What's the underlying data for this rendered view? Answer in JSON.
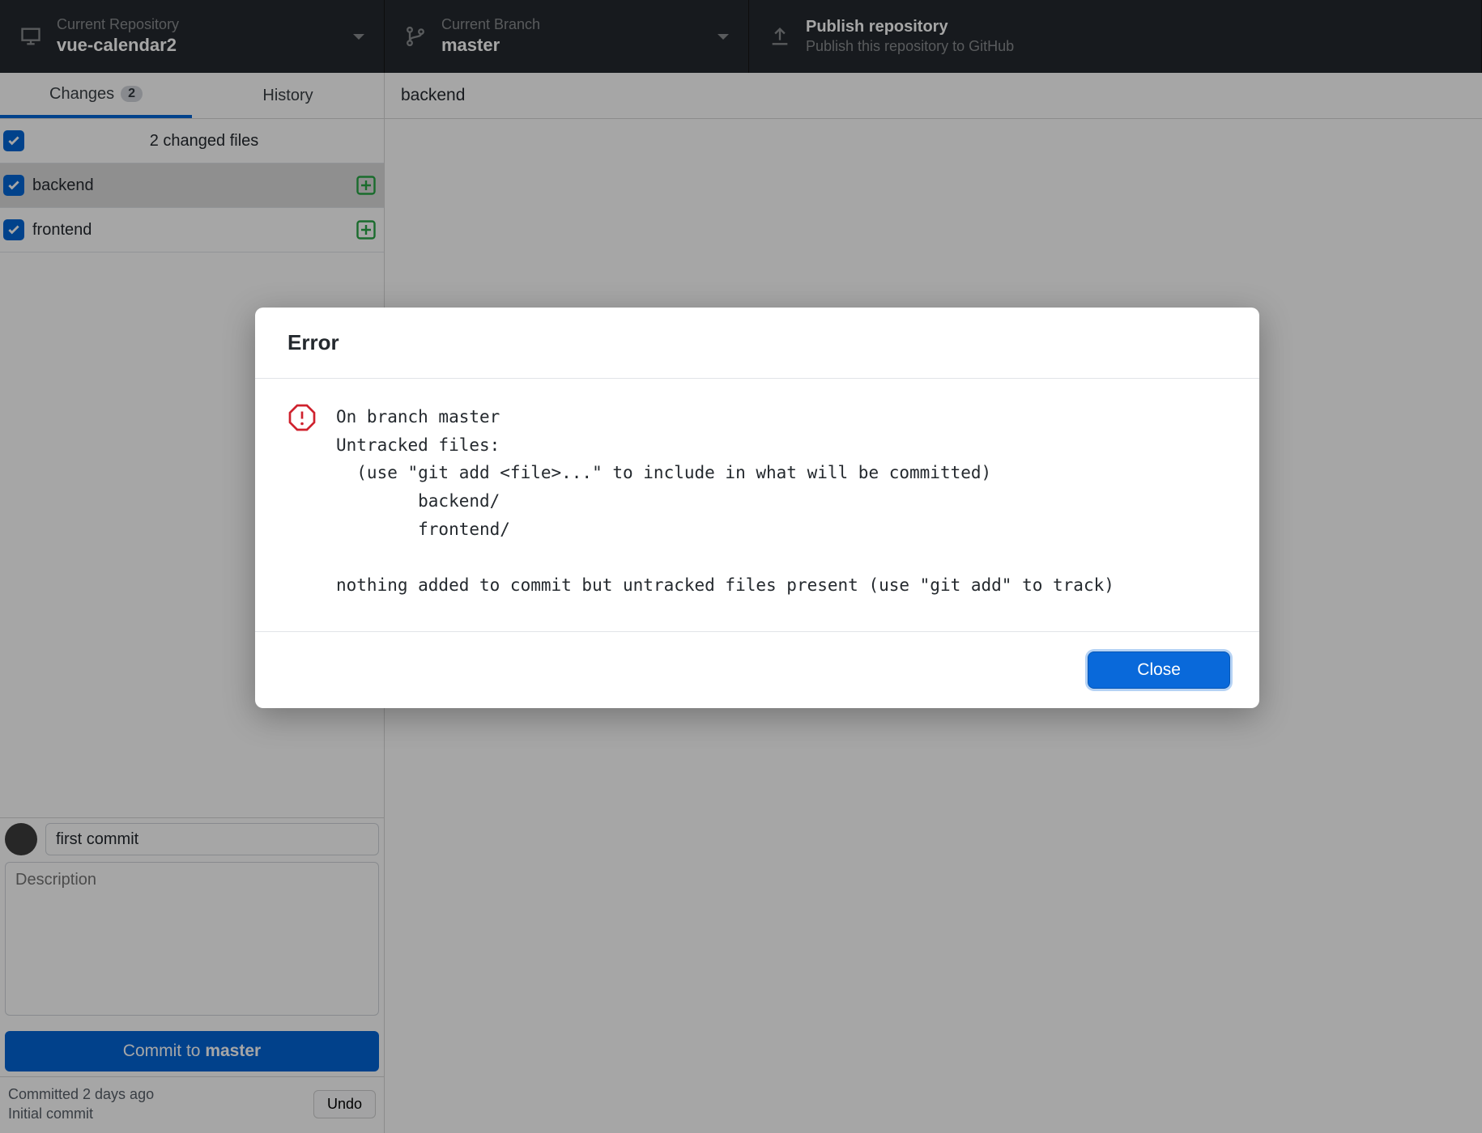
{
  "topbar": {
    "repo_caption": "Current Repository",
    "repo_value": "vue-calendar2",
    "branch_caption": "Current Branch",
    "branch_value": "master",
    "publish_caption": "Publish repository",
    "publish_value": "Publish this repository to GitHub"
  },
  "tabs": {
    "changes_label": "Changes",
    "changes_count": "2",
    "history_label": "History"
  },
  "changes": {
    "header": "2 changed files",
    "files": [
      {
        "name": "backend",
        "selected": true
      },
      {
        "name": "frontend",
        "selected": false
      }
    ]
  },
  "commit": {
    "summary_value": "first commit",
    "description_placeholder": "Description",
    "button_prefix": "Commit to ",
    "button_branch": "master"
  },
  "history": {
    "line1": "Committed 2 days ago",
    "line2": "Initial commit",
    "undo_label": "Undo"
  },
  "content": {
    "header": "backend"
  },
  "modal": {
    "title": "Error",
    "body": "On branch master\nUntracked files:\n  (use \"git add <file>...\" to include in what will be committed)\n        backend/\n        frontend/\n\nnothing added to commit but untracked files present (use \"git add\" to track)",
    "close_label": "Close"
  }
}
